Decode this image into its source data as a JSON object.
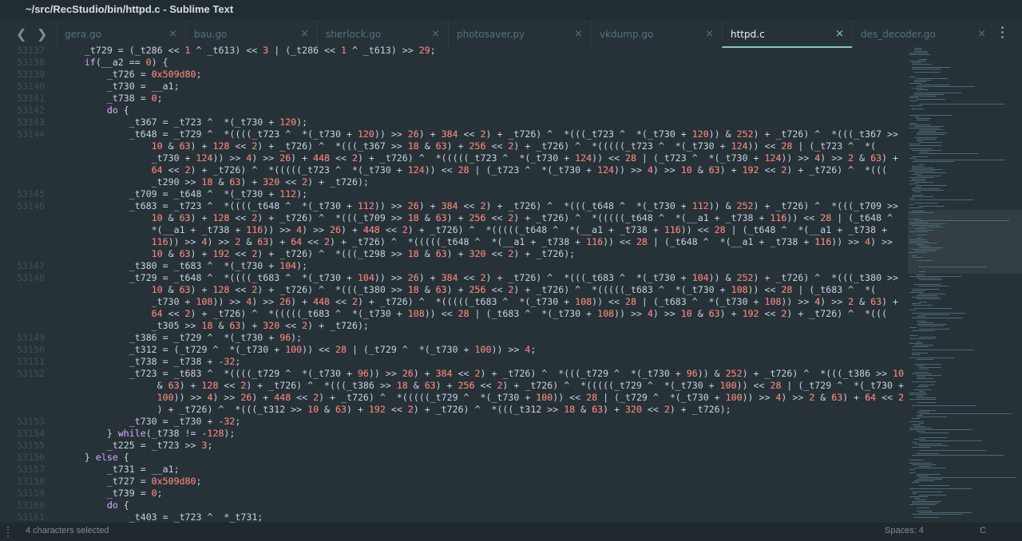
{
  "window": {
    "title": "~/src/RecStudio/bin/httpd.c - Sublime Text"
  },
  "tabs": [
    {
      "label": "gera.go",
      "active": false
    },
    {
      "label": "bau.go",
      "active": false
    },
    {
      "label": "sherlock.go",
      "active": false
    },
    {
      "label": "photosaver.py",
      "active": false
    },
    {
      "label": "vkdump.go",
      "active": false
    },
    {
      "label": "httpd.c",
      "active": true
    },
    {
      "label": "des_decoder.go",
      "active": false
    }
  ],
  "tab_close_glyph": "×",
  "nav": {
    "back": "❮",
    "forward": "❯"
  },
  "colors": {
    "accent": "#80cbc4",
    "number": "#f77669",
    "keyword": "#c792ea",
    "background": "#263238"
  },
  "code": [
    {
      "num": "53137",
      "rows": [
        "    _t729 = (_t286 << 1 ^ _t613) << 3 | (_t286 << 1 ^ _t613) >> 29;"
      ]
    },
    {
      "num": "53138",
      "rows": [
        "    if(__a2 == 0) {"
      ]
    },
    {
      "num": "53139",
      "rows": [
        "        _t726 = 0x509d80;"
      ]
    },
    {
      "num": "53140",
      "rows": [
        "        _t730 = __a1;"
      ]
    },
    {
      "num": "53141",
      "rows": [
        "        _t738 = 0;"
      ]
    },
    {
      "num": "53142",
      "rows": [
        "        do {"
      ]
    },
    {
      "num": "53143",
      "rows": [
        "            _t367 = _t723 ^  *(_t730 + 120);"
      ]
    },
    {
      "num": "53144",
      "rows": [
        "            _t648 = _t729 ^  *((((_t723 ^  *(_t730 + 120)) >> 26) + 384 << 2) + _t726) ^  *(((_t723 ^  *(_t730 + 120)) & 252) + _t726) ^  *(((_t367 >>",
        "                10 & 63) + 128 << 2) + _t726) ^  *(((_t367 >> 18 & 63) + 256 << 2) + _t726) ^  *(((((_t723 ^  *(_t730 + 124)) << 28 | (_t723 ^  *(",
        "                _t730 + 124)) >> 4) >> 26) + 448 << 2) + _t726) ^  *(((((_t723 ^  *(_t730 + 124)) << 28 | (_t723 ^  *(_t730 + 124)) >> 4) >> 2 & 63) +",
        "                64 << 2) + _t726) ^  *(((((_t723 ^  *(_t730 + 124)) << 28 | (_t723 ^  *(_t730 + 124)) >> 4) >> 10 & 63) + 192 << 2) + _t726) ^  *(((",
        "                _t290 >> 18 & 63) + 320 << 2) + _t726);"
      ]
    },
    {
      "num": "53145",
      "rows": [
        "            _t709 = _t648 ^  *(_t730 + 112);"
      ]
    },
    {
      "num": "53146",
      "rows": [
        "            _t683 = _t723 ^  *((((_t648 ^  *(_t730 + 112)) >> 26) + 384 << 2) + _t726) ^  *(((_t648 ^  *(_t730 + 112)) & 252) + _t726) ^  *(((_t709 >>",
        "                10 & 63) + 128 << 2) + _t726) ^  *(((_t709 >> 18 & 63) + 256 << 2) + _t726) ^  *(((((_t648 ^  *(__a1 + _t738 + 116)) << 28 | (_t648 ^",
        "                *(__a1 + _t738 + 116)) >> 4) >> 26) + 448 << 2) + _t726) ^  *(((((_t648 ^  *(__a1 + _t738 + 116)) << 28 | (_t648 ^  *(__a1 + _t738 +",
        "                116)) >> 4) >> 2 & 63) + 64 << 2) + _t726) ^  *(((((_t648 ^  *(__a1 + _t738 + 116)) << 28 | (_t648 ^  *(__a1 + _t738 + 116)) >> 4) >>",
        "                10 & 63) + 192 << 2) + _t726) ^  *(((_t298 >> 18 & 63) + 320 << 2) + _t726);"
      ]
    },
    {
      "num": "53147",
      "rows": [
        "            _t380 = _t683 ^  *(_t730 + 104);"
      ]
    },
    {
      "num": "53148",
      "rows": [
        "            _t729 = _t648 ^  *((((_t683 ^  *(_t730 + 104)) >> 26) + 384 << 2) + _t726) ^  *(((_t683 ^  *(_t730 + 104)) & 252) + _t726) ^  *(((_t380 >>",
        "                10 & 63) + 128 << 2) + _t726) ^  *(((_t380 >> 18 & 63) + 256 << 2) + _t726) ^  *(((((_t683 ^  *(_t730 + 108)) << 28 | (_t683 ^  *(",
        "                _t730 + 108)) >> 4) >> 26) + 448 << 2) + _t726) ^  *(((((_t683 ^  *(_t730 + 108)) << 28 | (_t683 ^  *(_t730 + 108)) >> 4) >> 2 & 63) +",
        "                64 << 2) + _t726) ^  *(((((_t683 ^  *(_t730 + 108)) << 28 | (_t683 ^  *(_t730 + 108)) >> 4) >> 10 & 63) + 192 << 2) + _t726) ^  *(((",
        "                _t305 >> 18 & 63) + 320 << 2) + _t726);"
      ]
    },
    {
      "num": "53149",
      "rows": [
        "            _t386 = _t729 ^  *(_t730 + 96);"
      ]
    },
    {
      "num": "53150",
      "rows": [
        "            _t312 = (_t729 ^  *(_t730 + 100)) << 28 | (_t729 ^  *(_t730 + 100)) >> 4;"
      ]
    },
    {
      "num": "53151",
      "rows": [
        "            _t738 = _t738 + -32;"
      ]
    },
    {
      "num": "53152",
      "rows": [
        "            _t723 = _t683 ^  *((((_t729 ^  *(_t730 + 96)) >> 26) + 384 << 2) + _t726) ^  *(((_t729 ^  *(_t730 + 96)) & 252) + _t726) ^  *(((_t386 >> 10",
        "                 & 63) + 128 << 2) + _t726) ^  *(((_t386 >> 18 & 63) + 256 << 2) + _t726) ^  *(((((_t729 ^  *(_t730 + 100)) << 28 | (_t729 ^  *(_t730 +",
        "                 100)) >> 4) >> 26) + 448 << 2) + _t726) ^  *(((((_t729 ^  *(_t730 + 100)) << 28 | (_t729 ^  *(_t730 + 100)) >> 4) >> 2 & 63) + 64 << 2",
        "                 ) + _t726) ^  *(((_t312 >> 10 & 63) + 192 << 2) + _t726) ^  *(((_t312 >> 18 & 63) + 320 << 2) + _t726);"
      ]
    },
    {
      "num": "53153",
      "rows": [
        "            _t730 = _t730 + -32;"
      ]
    },
    {
      "num": "53154",
      "rows": [
        "        } while(_t738 != -128);"
      ]
    },
    {
      "num": "53155",
      "rows": [
        "        _t225 = _t723 >> 3;"
      ]
    },
    {
      "num": "53156",
      "rows": [
        "    } else {"
      ]
    },
    {
      "num": "53157",
      "rows": [
        "        _t731 = __a1;"
      ]
    },
    {
      "num": "53158",
      "rows": [
        "        _t727 = 0x509d80;"
      ]
    },
    {
      "num": "53159",
      "rows": [
        "        _t739 = 0;"
      ]
    },
    {
      "num": "53160",
      "rows": [
        "        do {"
      ]
    },
    {
      "num": "53161",
      "rows": [
        "            _t403 = _t723 ^  *_t731;"
      ]
    }
  ],
  "statusbar": {
    "selection": "4 characters selected",
    "indentation": "Spaces: 4",
    "syntax": "C"
  }
}
